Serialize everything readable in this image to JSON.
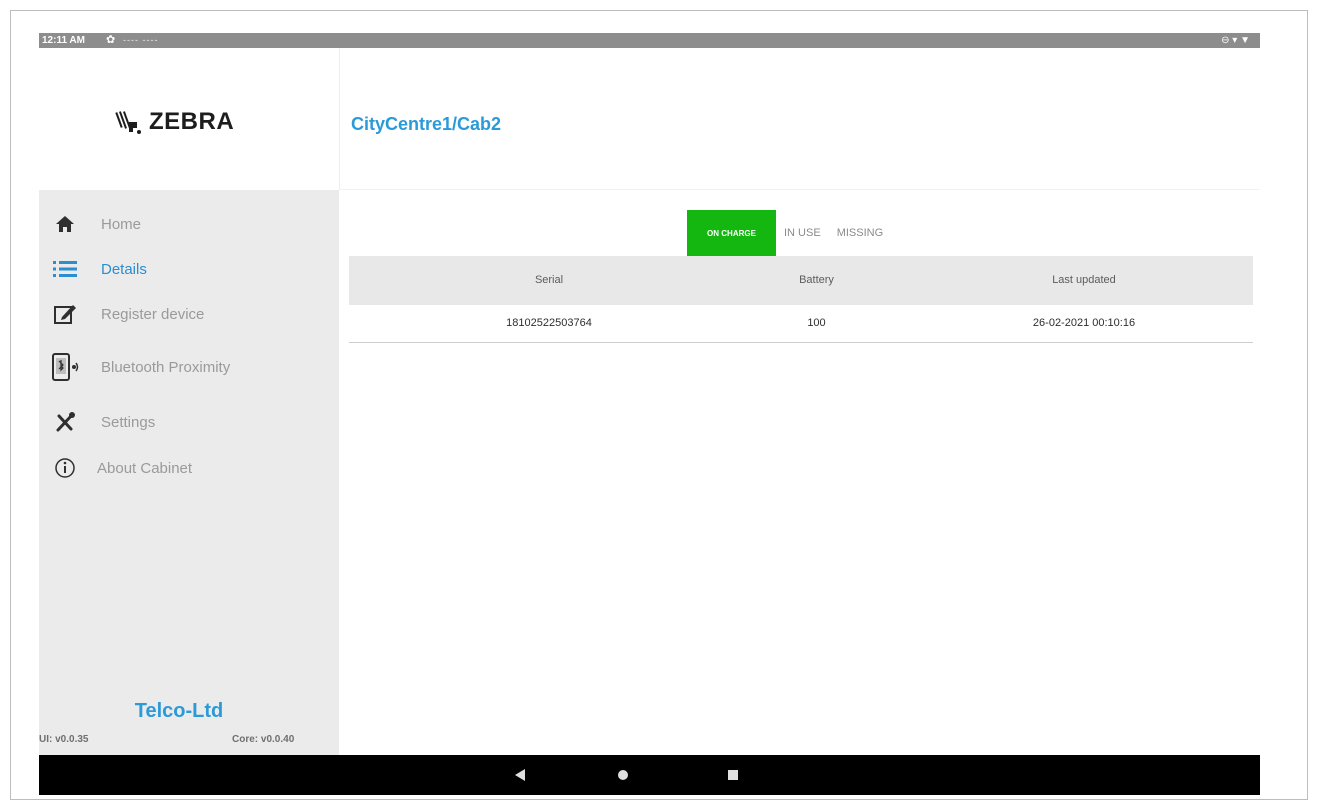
{
  "status_bar": {
    "time": "12:11 AM",
    "notifications": "---- ----",
    "right_icons": "⊖ ▾ ▼"
  },
  "brand": {
    "logo_text": "ZEBRA",
    "company": "Telco-Ltd",
    "ui_version": "UI: v0.0.35",
    "core_version": "Core: v0.0.40"
  },
  "header": {
    "title": "CityCentre1/Cab2"
  },
  "sidebar": {
    "items": [
      {
        "label": "Home",
        "icon": "home-icon",
        "active": false
      },
      {
        "label": "Details",
        "icon": "list-icon",
        "active": true
      },
      {
        "label": "Register device",
        "icon": "edit-icon",
        "active": false
      },
      {
        "label": "Bluetooth Proximity",
        "icon": "bluetooth-proximity-icon",
        "active": false
      },
      {
        "label": "Settings",
        "icon": "settings-tools-icon",
        "active": false
      },
      {
        "label": "About Cabinet",
        "icon": "info-icon",
        "active": false
      }
    ]
  },
  "tabs": [
    {
      "label": "ON CHARGE",
      "active": true
    },
    {
      "label": "IN USE",
      "active": false
    },
    {
      "label": "MISSING",
      "active": false
    }
  ],
  "table": {
    "headers": [
      "Serial",
      "Battery",
      "Last updated"
    ],
    "rows": [
      [
        "18102522503764",
        "100",
        "26-02-2021 00:10:16"
      ]
    ]
  },
  "colors": {
    "accent": "#2a9ad8",
    "active_tab": "#13b70f",
    "sidebar_bg": "#ebebeb",
    "navbar": "#000000"
  },
  "navbar": {
    "back_icon": "back-triangle-icon",
    "home_icon": "home-circle-icon",
    "recents_icon": "recents-square-icon"
  }
}
